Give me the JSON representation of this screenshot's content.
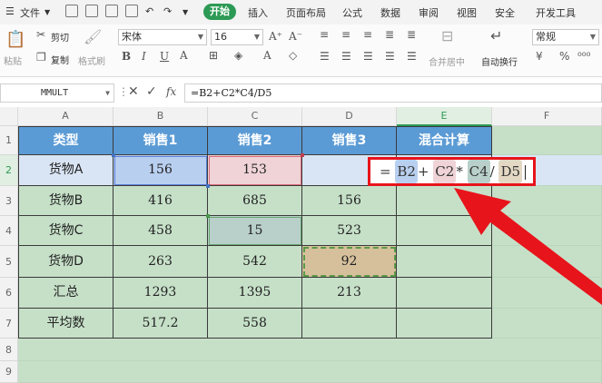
{
  "menu": {
    "file": "文件",
    "tabs": [
      "开始",
      "插入",
      "页面布局",
      "公式",
      "数据",
      "审阅",
      "视图",
      "安全",
      "开发工具"
    ]
  },
  "ribbon": {
    "paste": "粘贴",
    "cut": "剪切",
    "copy": "复制",
    "format_painter": "格式刷",
    "font_name": "宋体",
    "font_size": "16",
    "merge_center": "合并居中",
    "wrap_text": "自动换行",
    "number_format": "常规"
  },
  "formula_bar": {
    "name_box": "MMULT",
    "fx": "fx",
    "formula": "=B2+C2*C4/D5"
  },
  "columns": [
    "A",
    "B",
    "C",
    "D",
    "E",
    "F"
  ],
  "rows": [
    "1",
    "2",
    "3",
    "4",
    "5",
    "6",
    "7",
    "8",
    "9"
  ],
  "table": {
    "header": [
      "类型",
      "销售1",
      "销售2",
      "销售3",
      "混合计算"
    ],
    "rows": [
      [
        "货物A",
        "156",
        "153",
        "",
        ""
      ],
      [
        "货物B",
        "416",
        "685",
        "156",
        ""
      ],
      [
        "货物C",
        "458",
        "15",
        "523",
        ""
      ],
      [
        "货物D",
        "263",
        "542",
        "92",
        ""
      ],
      [
        "汇总",
        "1293",
        "1395",
        "213",
        ""
      ],
      [
        "平均数",
        "517.2",
        "558",
        "",
        ""
      ]
    ]
  },
  "edit_cell": {
    "eq": "=",
    "ref1": "B2",
    "op1": "+",
    "ref2": "C2",
    "op2": "*",
    "ref3": "C4",
    "op3": "/",
    "ref4": "D5"
  },
  "colors": {
    "header_blue": "#5b9bd5",
    "cell_green": "#c6e0c8",
    "row2_blue": "#d9e5f4",
    "annotation_red": "#e8141b",
    "tab_green": "#2c9a55"
  }
}
